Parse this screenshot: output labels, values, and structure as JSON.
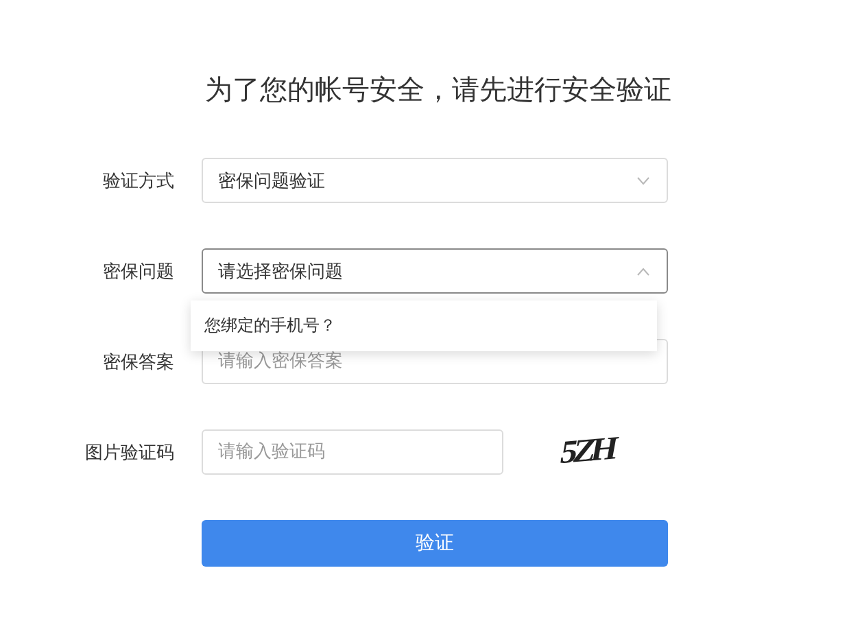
{
  "title": "为了您的帐号安全，请先进行安全验证",
  "fields": [
    {
      "kind": "select",
      "label": "验证方式",
      "value": "密保问题验证",
      "expanded": false
    },
    {
      "kind": "select",
      "label": "密保问题",
      "placeholder": "请选择密保问题",
      "expanded": true,
      "options": [
        "您绑定的手机号？"
      ]
    },
    {
      "kind": "input",
      "label": "密保答案",
      "placeholder": "请输入密保答案"
    },
    {
      "kind": "captcha",
      "label": "图片验证码",
      "placeholder": "请输入验证码",
      "captcha": "5ZH"
    }
  ],
  "submit": "验证"
}
